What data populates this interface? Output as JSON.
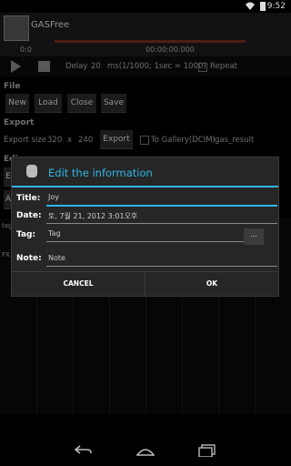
{
  "status_bar": {
    "time": "9:52",
    "wifi_icon": "wifi-icon",
    "battery_icon": "battery-icon"
  },
  "app": {
    "title": "GASFree",
    "time_start": "0:0",
    "time_current": "00:00:00.000"
  },
  "playback": {
    "delay_label": "Delay",
    "delay_value": "20",
    "delay_unit": "ms(1/1000; 1sec = 1000)",
    "repeat_label": "Repeat"
  },
  "file": {
    "section": "File",
    "buttons": [
      "New",
      "Load",
      "Close",
      "Save"
    ]
  },
  "export": {
    "section": "Export",
    "size_label": "Export size",
    "width": "320",
    "x": "x",
    "height": "240",
    "button": "Export",
    "gallery_label": "To Gallery(DCIM)",
    "filename": "gas_result"
  },
  "edit": {
    "section": "Edi",
    "btn1": "E",
    "btn2": "A"
  },
  "chart_labels": {
    "tag": "tag",
    "fx": "FX"
  },
  "dialog": {
    "title": "Edit the information",
    "fields": [
      {
        "label": "Title:",
        "value": "Joy"
      },
      {
        "label": "Date:",
        "value": "토, 7월 21, 2012 3:01오후"
      },
      {
        "label": "Tag:",
        "value": "Tag"
      },
      {
        "label": "Note:",
        "value": "Note"
      }
    ],
    "tag_button": "...",
    "cancel": "CANCEL",
    "ok": "OK"
  }
}
